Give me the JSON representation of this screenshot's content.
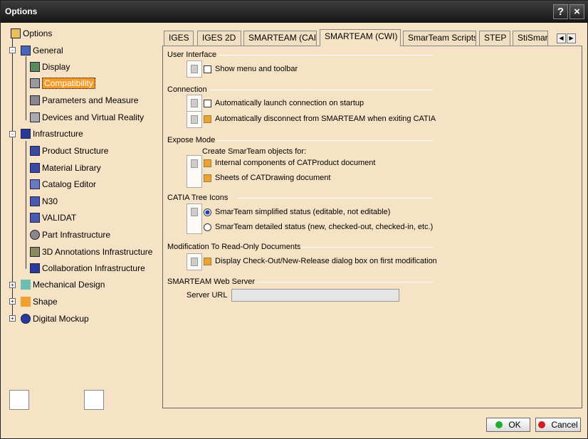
{
  "window": {
    "title": "Options",
    "help_glyph": "?",
    "close_glyph": "×"
  },
  "tree": {
    "root": "Options",
    "items": [
      "General",
      "Display",
      "Compatibility",
      "Parameters and Measure",
      "Devices and Virtual Reality",
      "Infrastructure",
      "Product Structure",
      "Material Library",
      "Catalog Editor",
      "N30",
      "VALIDAT",
      "Part Infrastructure",
      "3D Annotations Infrastructure",
      "Collaboration Infrastructure",
      "Mechanical Design",
      "Shape",
      "Digital Mockup"
    ],
    "selected": "Compatibility"
  },
  "tabs": [
    "IGES",
    "IGES 2D",
    "SMARTEAM (CAI)",
    "SMARTEAM (CWI)",
    "SmarTeam Scripts",
    "STEP",
    "StiSmartB"
  ],
  "active_tab": "SMARTEAM (CWI)",
  "sections": {
    "user_interface": {
      "title": "User Interface",
      "options": [
        {
          "label": "Show menu and toolbar",
          "checked": false
        }
      ]
    },
    "connection": {
      "title": "Connection",
      "options": [
        {
          "label": "Automatically launch connection on startup",
          "checked": false
        },
        {
          "label": "Automatically disconnect from SMARTEAM when exiting CATIA",
          "checked": true
        }
      ]
    },
    "expose": {
      "title": "Expose Mode",
      "subtitle": "Create SmarTeam objects for:",
      "options": [
        {
          "label": "Internal components of CATProduct document",
          "checked": true
        },
        {
          "label": "Sheets of CATDrawing document",
          "checked": true
        }
      ]
    },
    "tree_icons": {
      "title": "CATIA Tree Icons",
      "options": [
        {
          "label": "SmarTeam simplified status (editable, not editable)",
          "selected": true
        },
        {
          "label": "SmarTeam detailed status (new, checked-out, checked-in, etc.)",
          "selected": false
        }
      ]
    },
    "read_only": {
      "title": "Modification To Read-Only Documents",
      "options": [
        {
          "label": "Display Check-Out/New-Release dialog box on first modification",
          "checked": true
        }
      ]
    },
    "web_server": {
      "title": "SMARTEAM Web Server",
      "url_label": "Server URL",
      "url_value": ""
    }
  },
  "buttons": {
    "ok": "OK",
    "cancel": "Cancel"
  },
  "colors": {
    "background": "#f6e3c6",
    "selection": "#f59a25",
    "ok": "#1fae2f",
    "cancel": "#d01f1f"
  }
}
